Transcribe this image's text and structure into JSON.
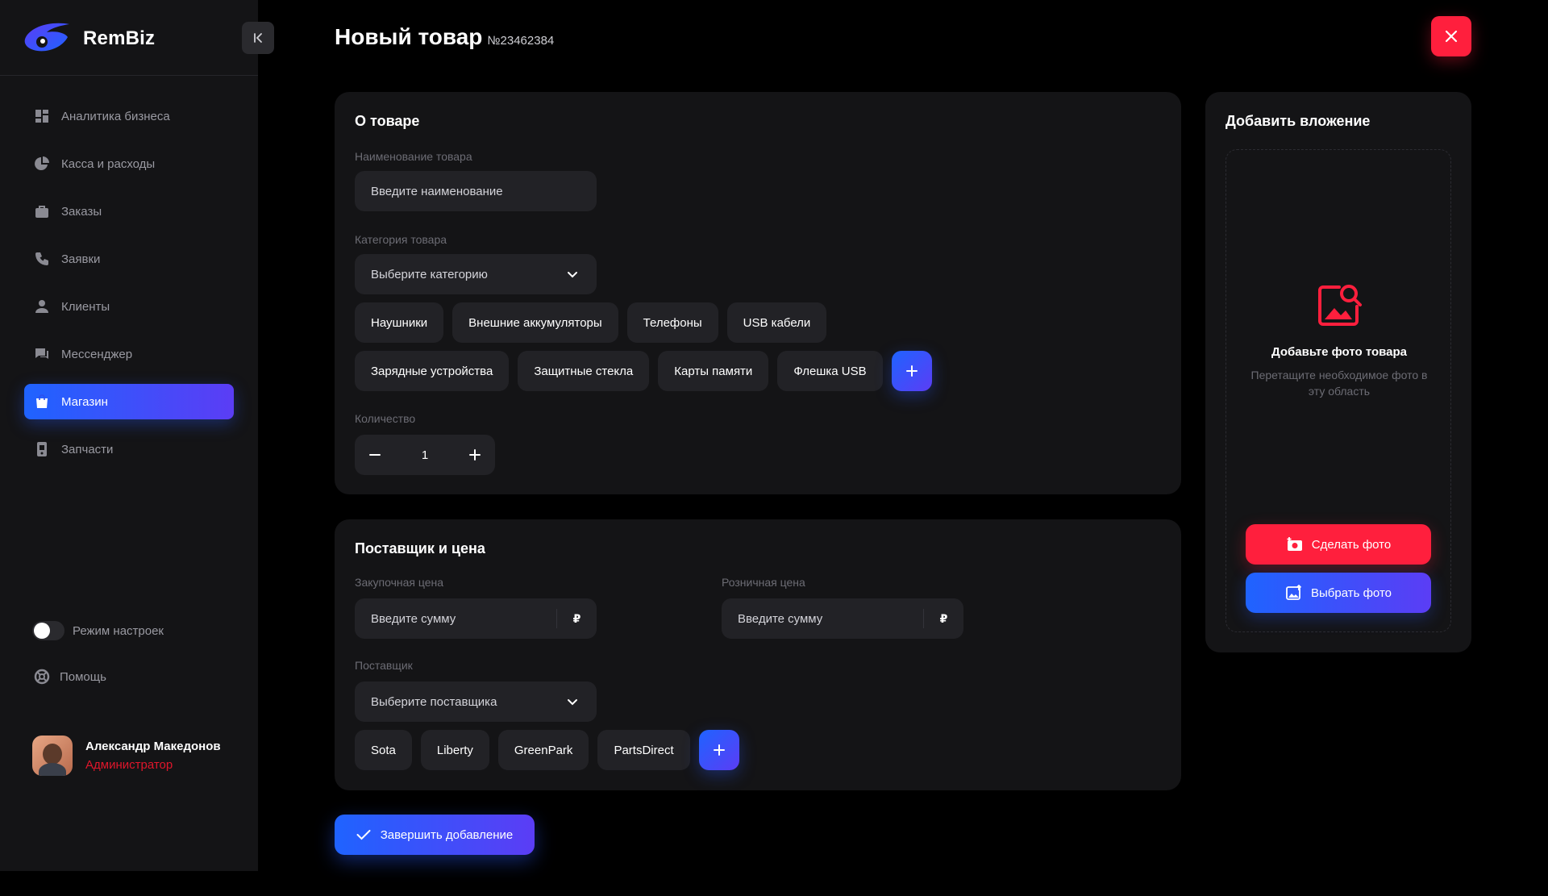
{
  "app": {
    "brand": "RemBiz"
  },
  "sidebar": {
    "items": [
      {
        "label": "Аналитика бизнеса",
        "icon": "dashboard-icon",
        "active": false
      },
      {
        "label": "Касса и расходы",
        "icon": "pie-chart-icon",
        "active": false
      },
      {
        "label": "Заказы",
        "icon": "briefcase-icon",
        "active": false
      },
      {
        "label": "Заявки",
        "icon": "phone-icon",
        "active": false
      },
      {
        "label": "Клиенты",
        "icon": "user-icon",
        "active": false
      },
      {
        "label": "Мессенджер",
        "icon": "chat-icon",
        "active": false
      },
      {
        "label": "Магазин",
        "icon": "shopping-bag-icon",
        "active": true
      },
      {
        "label": "Запчасти",
        "icon": "device-icon",
        "active": false
      }
    ],
    "settings_mode_label": "Режим настроек",
    "settings_mode_on": false,
    "help_label": "Помощь",
    "user": {
      "name": "Александр Македонов",
      "role": "Администратор"
    }
  },
  "header": {
    "title": "Новый товар",
    "number": "№23462384"
  },
  "about": {
    "title": "О товаре",
    "name_label": "Наименование товара",
    "name_placeholder": "Введите наименование",
    "category_label": "Категория товара",
    "category_placeholder": "Выберите категорию",
    "categories": [
      "Наушники",
      "Внешние аккумуляторы",
      "Телефоны",
      "USB кабели"
    ],
    "categories_row2": [
      "Зарядные устройства",
      "Защитные стекла",
      "Карты памяти",
      "Флешка USB"
    ],
    "quantity_label": "Количество",
    "quantity": "1"
  },
  "supplier": {
    "title": "Поставщик и цена",
    "purchase_label": "Закупочная цена",
    "purchase_placeholder": "Введите сумму",
    "retail_label": "Розничная цена",
    "retail_placeholder": "Введите сумму",
    "currency": "₽",
    "supplier_label": "Поставщик",
    "supplier_placeholder": "Выберите поставщика",
    "suppliers": [
      "Sota",
      "Liberty",
      "GreenPark",
      "PartsDirect"
    ]
  },
  "attach": {
    "title": "Добавить вложение",
    "drop_title": "Добавьте фото товара",
    "drop_sub": "Перетащите необходимое фото в эту область",
    "take_photo": "Сделать фото",
    "choose_photo": "Выбрать фото"
  },
  "finish_label": "Завершить добавление",
  "colors": {
    "accent_blue": "#1f63ff",
    "accent_red": "#ff1f3d",
    "panel": "#141416"
  }
}
